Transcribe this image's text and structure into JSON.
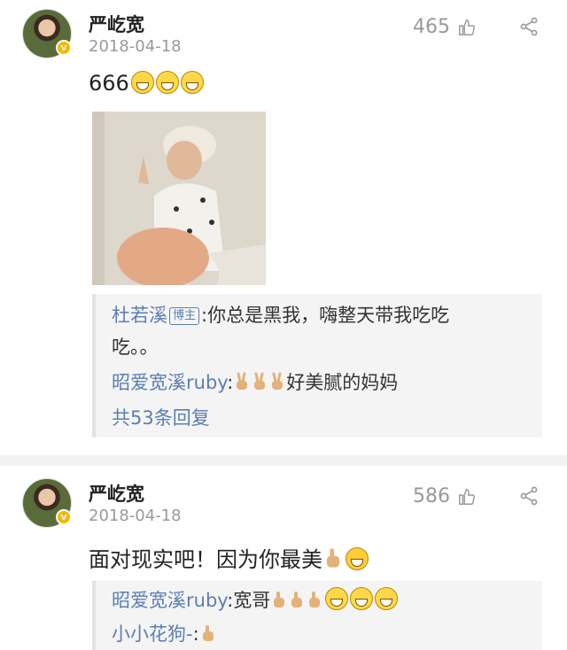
{
  "comments": [
    {
      "author": "严屹宽",
      "date": "2018-04-18",
      "likes": "465",
      "text": "666",
      "replies": {
        "r1_user": "杜若溪",
        "r1_tag": "博主",
        "r1_text_a": ":你总是黑我，嗨整天带我吃吃",
        "r1_text_b": "吃。。",
        "r2_user": "昭爱宽溪ruby",
        "r2_text": "好美腻的妈妈",
        "more": "共53条回复"
      }
    },
    {
      "author": "严屹宽",
      "date": "2018-04-18",
      "likes": "586",
      "text": "面对现实吧！因为你最美",
      "replies": {
        "r1_user": "昭爱宽溪ruby",
        "r1_text": ":宽哥",
        "r2_user": "小小花狗-",
        "r2_text": ":"
      }
    }
  ],
  "colors": {
    "link": "#5b7fb0",
    "muted": "#999999",
    "badge": "#f5b800"
  },
  "icons": [
    "verified-badge-icon",
    "thumb-up-icon",
    "share-icon",
    "grin-emoji-icon",
    "victory-hand-icon",
    "thumbs-up-hand-icon",
    "blush-emoji-icon"
  ]
}
